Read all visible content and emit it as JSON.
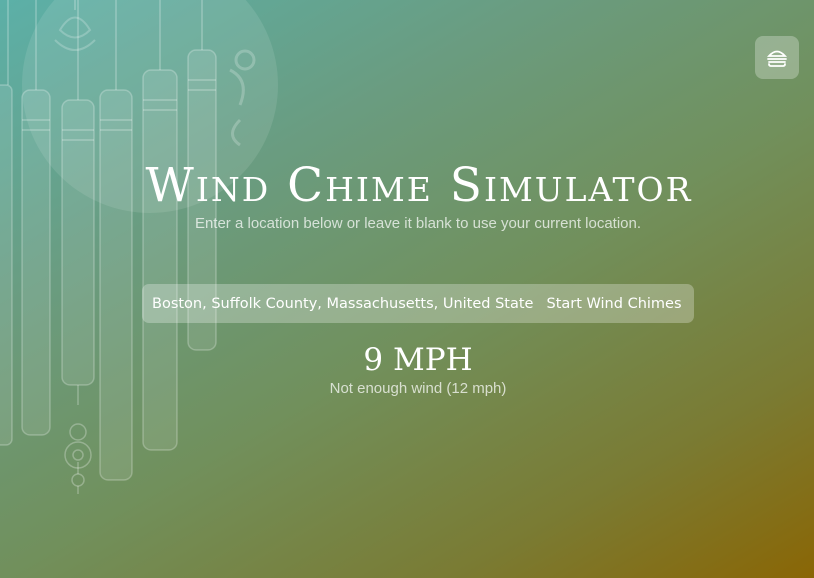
{
  "app": {
    "title": "Wind Chime Simulator",
    "subtitle": "Enter a location below or leave it blank to use your current location."
  },
  "menu": {
    "icon": "hamburger-icon"
  },
  "location": {
    "value": "Boston, Suffolk County, Massachusetts, United States",
    "start_label": "Start Wind Chimes"
  },
  "wind": {
    "speed": "9 MPH",
    "status": "Not enough wind (12 mph)"
  },
  "decoration": {
    "icon": "wind-chime-illustration"
  },
  "colors": {
    "gradient_start": "#5cb0a8",
    "gradient_end": "#8a6605",
    "text": "#ffffff"
  }
}
